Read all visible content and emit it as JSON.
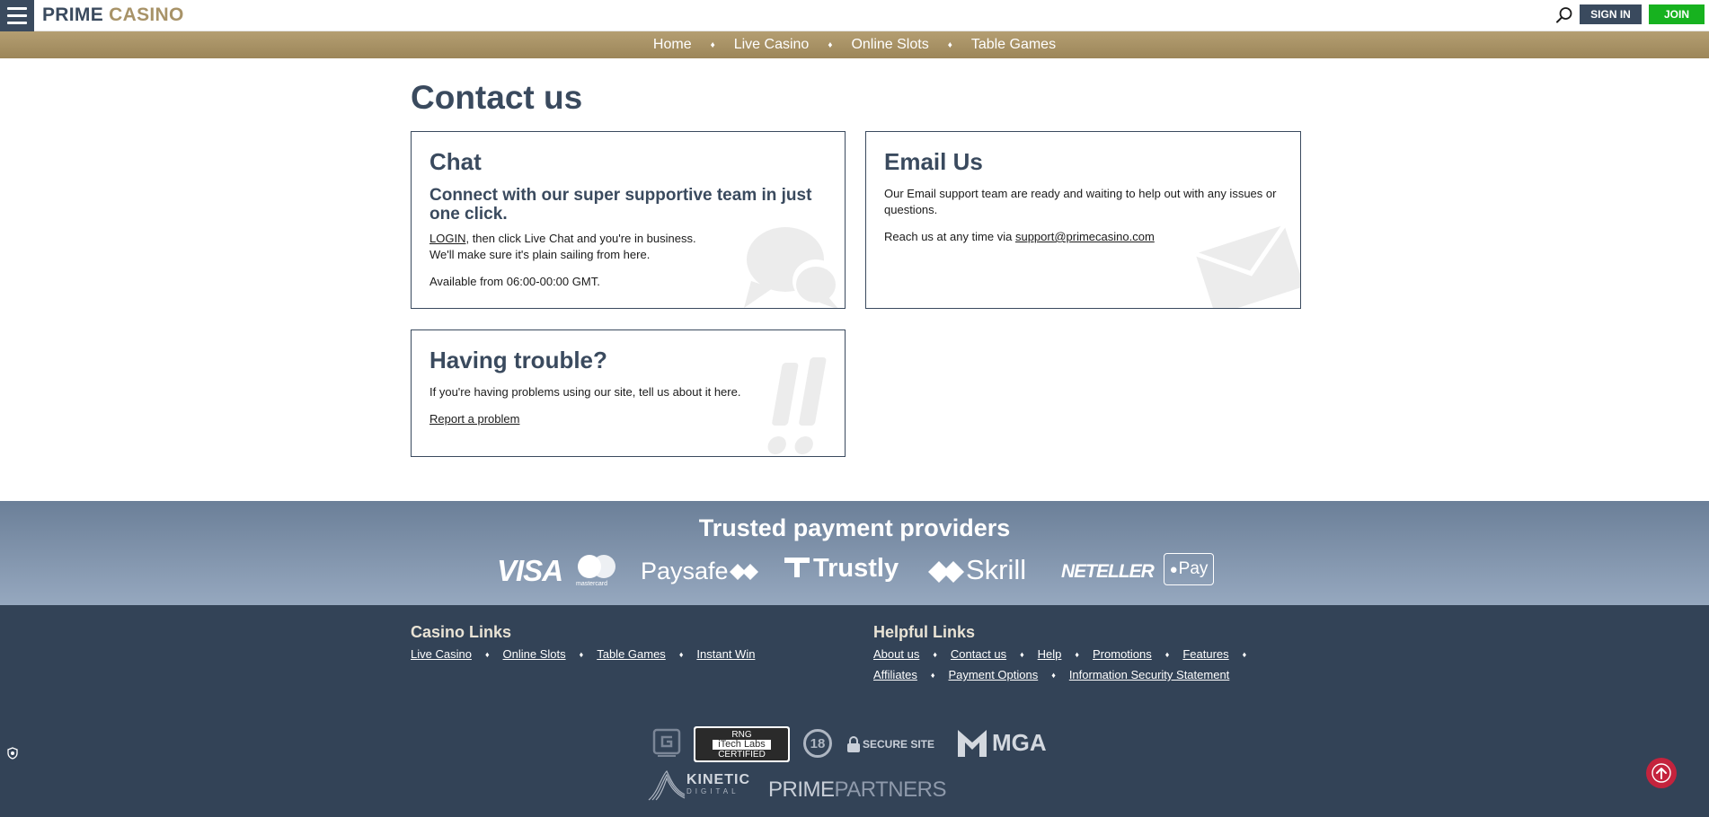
{
  "header": {
    "logo_prime": "PRIME",
    "logo_casino": "CASINO",
    "signin_label": "SIGN IN",
    "join_label": "JOIN"
  },
  "nav": {
    "items": [
      "Home",
      "Live Casino",
      "Online Slots",
      "Table Games"
    ]
  },
  "page": {
    "title": "Contact us"
  },
  "chat": {
    "title": "Chat",
    "subtitle": "Connect with our super supportive team in just one click.",
    "login_link": "LOGIN",
    "line1_rest": ", then click Live Chat and you're in business.",
    "line2": "We'll make sure it's plain sailing from here.",
    "availability": "Available from 06:00-00:00 GMT."
  },
  "email": {
    "title": "Email Us",
    "body": "Our Email support team are ready and waiting to help out with any issues or questions.",
    "reach_prefix": "Reach us at any time via ",
    "address": "support@primecasino.com"
  },
  "trouble": {
    "title": "Having trouble?",
    "body": "If you're having problems using our site, tell us about it here.",
    "report_link": "Report a problem"
  },
  "payments": {
    "title": "Trusted payment providers",
    "providers": {
      "visa": "VISA",
      "mastercard": "mastercard",
      "paysafe": "Paysafe",
      "trustly": "Trustly",
      "skrill": "Skrill",
      "neteller": "NETELLER",
      "applepay": "Pay"
    }
  },
  "footer": {
    "casino_title": "Casino Links",
    "casino_links": [
      "Live Casino",
      "Online Slots",
      "Table Games",
      "Instant Win"
    ],
    "helpful_title": "Helpful Links",
    "helpful_links_row1": [
      "About us",
      "Contact us",
      "Help",
      "Promotions",
      "Features"
    ],
    "helpful_links_row2": [
      "Affiliates",
      "Payment Options",
      "Information Security Statement"
    ],
    "badges": {
      "rng_line1": "RNG",
      "rng_line2": "iTech Labs",
      "rng_line3": "CERTIFIED",
      "age": "18",
      "secure": "SECURE SITE",
      "mga": "MGA",
      "kinetic": "KINETIC",
      "kinetic_sub": "DIGITAL",
      "partners_prime": "PRIME",
      "partners_rest": "PARTNERS"
    }
  },
  "colors": {
    "navy": "#3a4a5e",
    "gold": "#a89368",
    "join_green": "#17b21f",
    "footer_bg": "#334357",
    "to_top_red": "#c4233d"
  }
}
